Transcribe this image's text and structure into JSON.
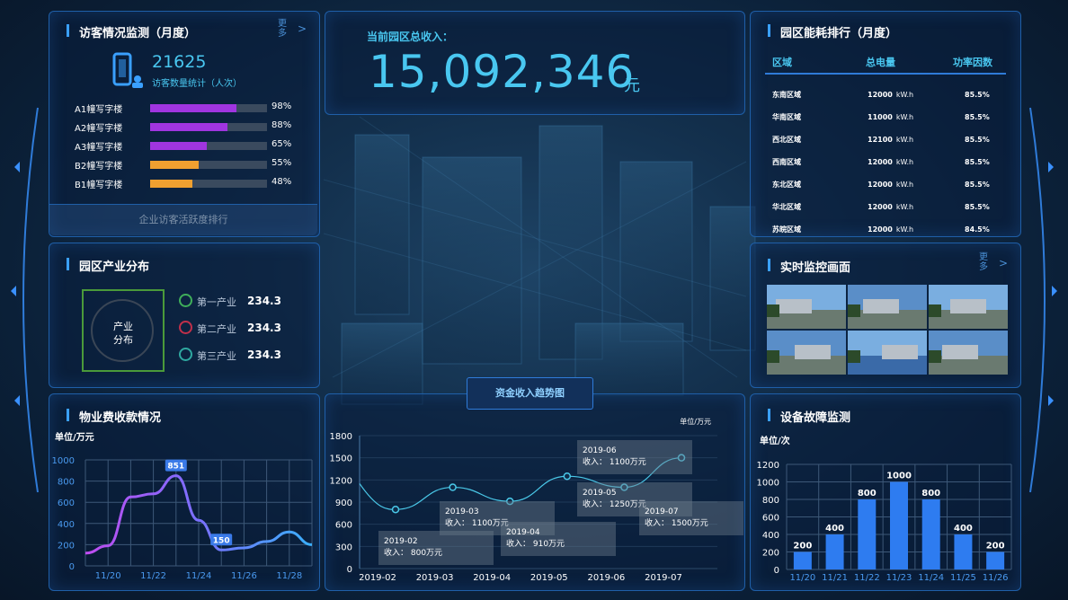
{
  "visitor": {
    "title": "访客情况监测（月度）",
    "more": "更多",
    "count": "21625",
    "count_label": "访客数量统计（人次）",
    "bars": [
      {
        "label": "A1幢写字楼",
        "pct": "98%",
        "level": 0.98,
        "color": "#a035e0"
      },
      {
        "label": "A2幢写字楼",
        "pct": "88%",
        "level": 0.88,
        "color": "#a035e0"
      },
      {
        "label": "A3幢写字楼",
        "pct": "65%",
        "level": 0.65,
        "color": "#a035e0"
      },
      {
        "label": "B2幢写字楼",
        "pct": "55%",
        "level": 0.55,
        "color": "#f0a030"
      },
      {
        "label": "B1幢写字楼",
        "pct": "48%",
        "level": 0.48,
        "color": "#f0a030"
      }
    ],
    "button": "企业访客活跃度排行"
  },
  "revenue": {
    "label": "当前园区总收入：",
    "value": "15,092,346",
    "unit": "元"
  },
  "energy": {
    "title": "园区能耗排行（月度）",
    "headers": [
      "区域",
      "总电量",
      "功率因数"
    ],
    "rows": [
      [
        "东南区域",
        "12000",
        "kW.h",
        "85.5%"
      ],
      [
        "华南区域",
        "11000",
        "kW.h",
        "85.5%"
      ],
      [
        "西北区域",
        "12100",
        "kW.h",
        "85.5%"
      ],
      [
        "西南区域",
        "12000",
        "kW.h",
        "85.5%"
      ],
      [
        "东北区域",
        "12000",
        "kW.h",
        "85.5%"
      ],
      [
        "华北区域",
        "12000",
        "kW.h",
        "85.5%"
      ],
      [
        "苏皖区域",
        "12000",
        "kW.h",
        "84.5%"
      ]
    ]
  },
  "industry": {
    "title": "园区产业分布",
    "center": [
      "产业",
      "分布"
    ],
    "items": [
      {
        "name": "第一产业",
        "value": "234.3",
        "color": "#3fae5a"
      },
      {
        "name": "第二产业",
        "value": "234.3",
        "color": "#c0304a"
      },
      {
        "name": "第三产业",
        "value": "234.3",
        "color": "#2fa8a0"
      }
    ]
  },
  "monitor": {
    "title": "实时监控画面",
    "more": "更多"
  },
  "fees": {
    "title": "物业费收款情况"
  },
  "trend_title": "资金收入趋势图",
  "faults": {
    "title": "设备故障监测"
  },
  "chart_data": [
    {
      "type": "line",
      "unit": "单位/万元",
      "categories": [
        "11/20",
        "11/22",
        "11/24",
        "11/26",
        "11/28"
      ],
      "x": [
        "11/19",
        "11/20",
        "11/21",
        "11/22",
        "11/23",
        "11/24",
        "11/25",
        "11/26",
        "11/27",
        "11/28",
        "11/29"
      ],
      "values": [
        120,
        190,
        650,
        680,
        851,
        430,
        150,
        170,
        230,
        320,
        200
      ],
      "yticks": [
        0,
        200,
        400,
        600,
        800,
        1000
      ],
      "ylim": [
        0,
        1000
      ],
      "labels": [
        {
          "x": "11/23",
          "text": "851"
        },
        {
          "x": "11/25",
          "text": "150"
        }
      ],
      "grid": true
    },
    {
      "type": "line",
      "unit": "单位/万元",
      "categories": [
        "2019-02",
        "2019-03",
        "2019-04",
        "2019-05",
        "2019-06",
        "2019-07"
      ],
      "values": [
        800,
        1100,
        910,
        1250,
        1100,
        1500
      ],
      "yticks": [
        0,
        300,
        600,
        900,
        1200,
        1500,
        1800
      ],
      "ylim": [
        0,
        1800
      ],
      "labels": [
        {
          "month": "2019-02",
          "text": "收入： 800万元"
        },
        {
          "month": "2019-03",
          "text": "收入： 1100万元"
        },
        {
          "month": "2019-04",
          "text": "收入： 910万元"
        },
        {
          "month": "2019-05",
          "text": "收入： 1250万元"
        },
        {
          "month": "2019-06",
          "text": "收入： 1100万元"
        },
        {
          "month": "2019-07",
          "text": "收入： 1500万元"
        }
      ],
      "grid": true
    },
    {
      "type": "bar",
      "unit": "单位/次",
      "categories": [
        "11/20",
        "11/21",
        "11/22",
        "11/23",
        "11/24",
        "11/25",
        "11/26"
      ],
      "values": [
        200,
        400,
        800,
        1000,
        800,
        400,
        200
      ],
      "yticks": [
        0,
        200,
        400,
        600,
        800,
        1000,
        1200
      ],
      "ylim": [
        0,
        1200
      ],
      "grid": true
    }
  ]
}
